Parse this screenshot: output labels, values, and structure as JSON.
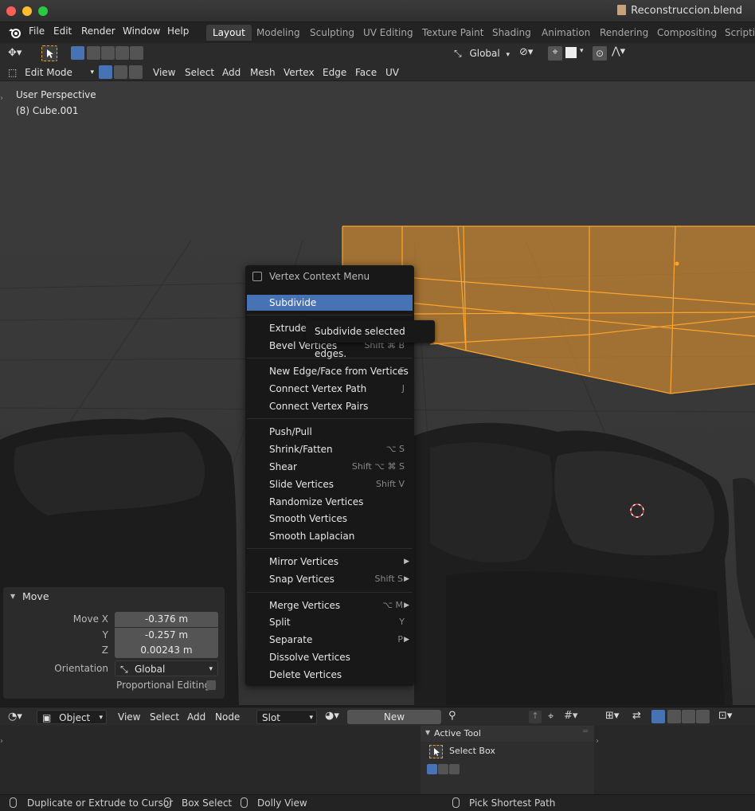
{
  "window": {
    "title": "Reconstruccion.blend"
  },
  "menubar": {
    "items": [
      "File",
      "Edit",
      "Render",
      "Window",
      "Help"
    ],
    "workspaces": [
      "Layout",
      "Modeling",
      "Sculpting",
      "UV Editing",
      "Texture Paint",
      "Shading",
      "Animation",
      "Rendering",
      "Compositing",
      "Scriptin"
    ],
    "active_workspace": "Layout"
  },
  "toolheader": {
    "orientation": "Global"
  },
  "header": {
    "mode": "Edit Mode",
    "menus": [
      "View",
      "Select",
      "Add",
      "Mesh",
      "Vertex",
      "Edge",
      "Face",
      "UV"
    ]
  },
  "viewport": {
    "perspective_label": "User Perspective",
    "object_label": "(8) Cube.001"
  },
  "context_menu": {
    "title": "Vertex Context Menu",
    "items": [
      {
        "label": "Subdivide",
        "shortcut": "",
        "highlighted": true
      },
      {
        "label": "Extrude",
        "shortcut": ""
      },
      {
        "label": "Bevel Vertices",
        "shortcut": "Shift ⌘ B"
      },
      {
        "label": "New Edge/Face from Vertices",
        "shortcut": "F"
      },
      {
        "label": "Connect Vertex Path",
        "shortcut": "J"
      },
      {
        "label": "Connect Vertex Pairs",
        "shortcut": ""
      },
      {
        "label": "Push/Pull",
        "shortcut": ""
      },
      {
        "label": "Shrink/Fatten",
        "shortcut": "⌥ S"
      },
      {
        "label": "Shear",
        "shortcut": "Shift ⌥ ⌘ S"
      },
      {
        "label": "Slide Vertices",
        "shortcut": "Shift V"
      },
      {
        "label": "Randomize Vertices",
        "shortcut": ""
      },
      {
        "label": "Smooth Vertices",
        "shortcut": ""
      },
      {
        "label": "Smooth Laplacian",
        "shortcut": ""
      },
      {
        "label": "Mirror Vertices",
        "shortcut": ""
      },
      {
        "label": "Snap Vertices",
        "shortcut": "Shift S"
      },
      {
        "label": "Merge Vertices",
        "shortcut": "⌥ M"
      },
      {
        "label": "Split",
        "shortcut": "Y"
      },
      {
        "label": "Separate",
        "shortcut": "P"
      },
      {
        "label": "Dissolve Vertices",
        "shortcut": ""
      },
      {
        "label": "Delete Vertices",
        "shortcut": ""
      }
    ],
    "tooltip": "Subdivide selected edges."
  },
  "move_panel": {
    "title": "Move",
    "move_x_label": "Move X",
    "move_x": "-0.376 m",
    "y_label": "Y",
    "y": "-0.257 m",
    "z_label": "Z",
    "z": "0.00243 m",
    "orientation_label": "Orientation",
    "orientation": "Global",
    "proportional_label": "Proportional Editing"
  },
  "lower_editor": {
    "object_dropdown": "Object",
    "menus": [
      "View",
      "Select",
      "Add",
      "Node"
    ],
    "slot": "Slot",
    "new_label": "New",
    "plus": "+"
  },
  "active_tool": {
    "header": "Active Tool",
    "tool": "Select Box"
  },
  "statusbar": {
    "hint1": "Duplicate or Extrude to Cursor",
    "hint2": "Box Select",
    "hint3": "Dolly View",
    "hint4": "Pick Shortest Path"
  },
  "colors": {
    "accent": "#4772b3",
    "selection_orange": "#f5a030",
    "menu_bg": "#181818"
  }
}
